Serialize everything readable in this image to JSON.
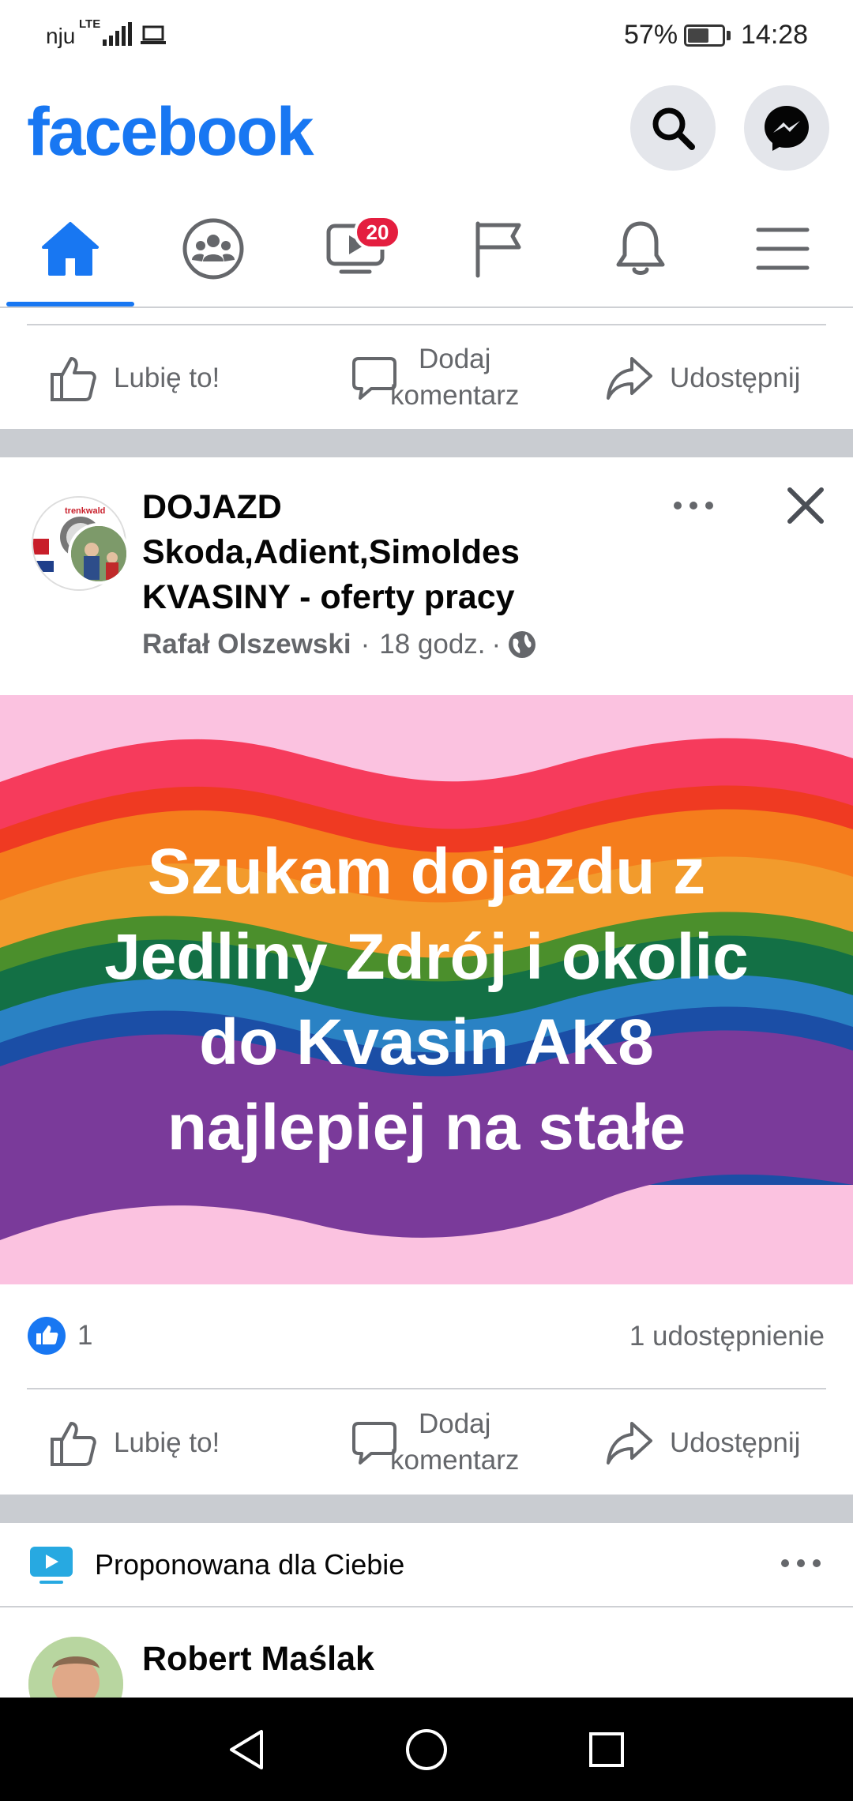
{
  "status_bar": {
    "carrier": "nju",
    "network": "LTE",
    "battery_percent": "57%",
    "battery_level": 0.57,
    "time": "14:28"
  },
  "header": {
    "logo": "facebook",
    "search_icon": "search-icon",
    "messenger_icon": "messenger-icon"
  },
  "tabs": {
    "items": [
      {
        "name": "home",
        "icon": "home-icon",
        "active": true
      },
      {
        "name": "groups",
        "icon": "groups-icon"
      },
      {
        "name": "watch",
        "icon": "video-icon",
        "badge": "20"
      },
      {
        "name": "pages",
        "icon": "flag-icon"
      },
      {
        "name": "notifications",
        "icon": "bell-icon"
      },
      {
        "name": "menu",
        "icon": "hamburger-icon"
      }
    ]
  },
  "actions": {
    "like": "Lubię to!",
    "comment_line1": "Dodaj",
    "comment_line2": "komentarz",
    "share": "Udostępnij"
  },
  "post": {
    "group_line1": "DOJAZD",
    "group_line2": "Skoda,Adient,Simoldes",
    "group_line3": "KVASINY - oferty pracy",
    "author": "Rafał Olszewski",
    "time": "18 godz.",
    "dot": "·",
    "privacy_icon": "globe-icon",
    "avatar_text": "trenkwald",
    "image_lines": [
      "Szukam dojazdu z",
      "Jedliny Zdrój i okolic",
      "do Kvasin AK8",
      "najlepiej na stałe"
    ],
    "like_count": "1",
    "share_count": "1 udostępnienie"
  },
  "suggested": {
    "label": "Proponowana dla Ciebie",
    "next_author": "Robert Maślak"
  },
  "colors": {
    "brand": "#1877f2",
    "badge": "#e41e3f",
    "separator": "#c9ccd1",
    "secondary_text": "#65676b"
  }
}
